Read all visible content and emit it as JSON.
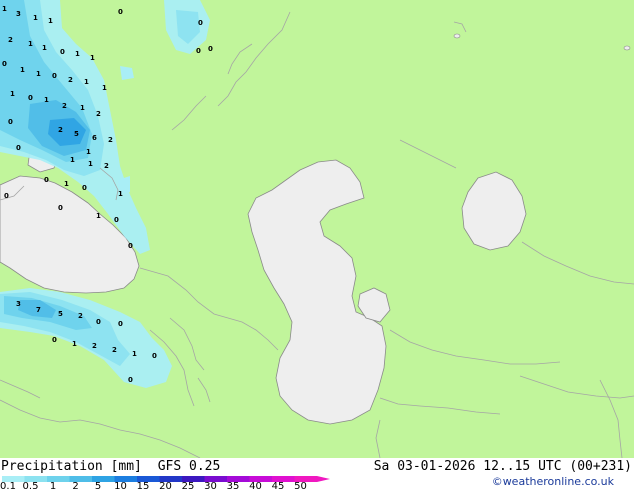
{
  "title": {
    "product": "Precipitation [mm]",
    "model": "GFS 0.25",
    "datetime": "Sa 03-01-2026 12..15 UTC (00+231)"
  },
  "credit": "©weatheronline.co.uk",
  "colors": {
    "land": "#c1f59b",
    "water": "#eeeeee",
    "border": "#a5a5a5",
    "coast": "#8a8a8a"
  },
  "legend": {
    "labels": [
      "0.1",
      "0.5",
      "1",
      "2",
      "5",
      "10",
      "15",
      "20",
      "25",
      "30",
      "35",
      "40",
      "45",
      "50"
    ],
    "colors": [
      "#a9eef6",
      "#8ce2f0",
      "#6ed2ec",
      "#4fbde8",
      "#2ea3e4",
      "#1c7ee0",
      "#1a58d6",
      "#2237c8",
      "#3c18c0",
      "#7a0cd0",
      "#a40ad8",
      "#c80cd8",
      "#e010d0",
      "#f018c0"
    ]
  },
  "map_labels": [
    "1",
    "3",
    "1",
    "1",
    "0",
    "0",
    "2",
    "1",
    "1",
    "0",
    "0",
    "0",
    "1",
    "0",
    "1",
    "1",
    "1",
    "0",
    "2",
    "1",
    "1",
    "1",
    "0",
    "1",
    "2",
    "1",
    "2",
    "0",
    "2",
    "5",
    "6",
    "2",
    "0",
    "1",
    "1",
    "2",
    "1",
    "0",
    "1",
    "0",
    "0",
    "0",
    "1",
    "1",
    "0",
    "0",
    "3",
    "7",
    "5",
    "2",
    "0",
    "0",
    "0",
    "1",
    "2",
    "2",
    "1",
    "0",
    "0"
  ]
}
